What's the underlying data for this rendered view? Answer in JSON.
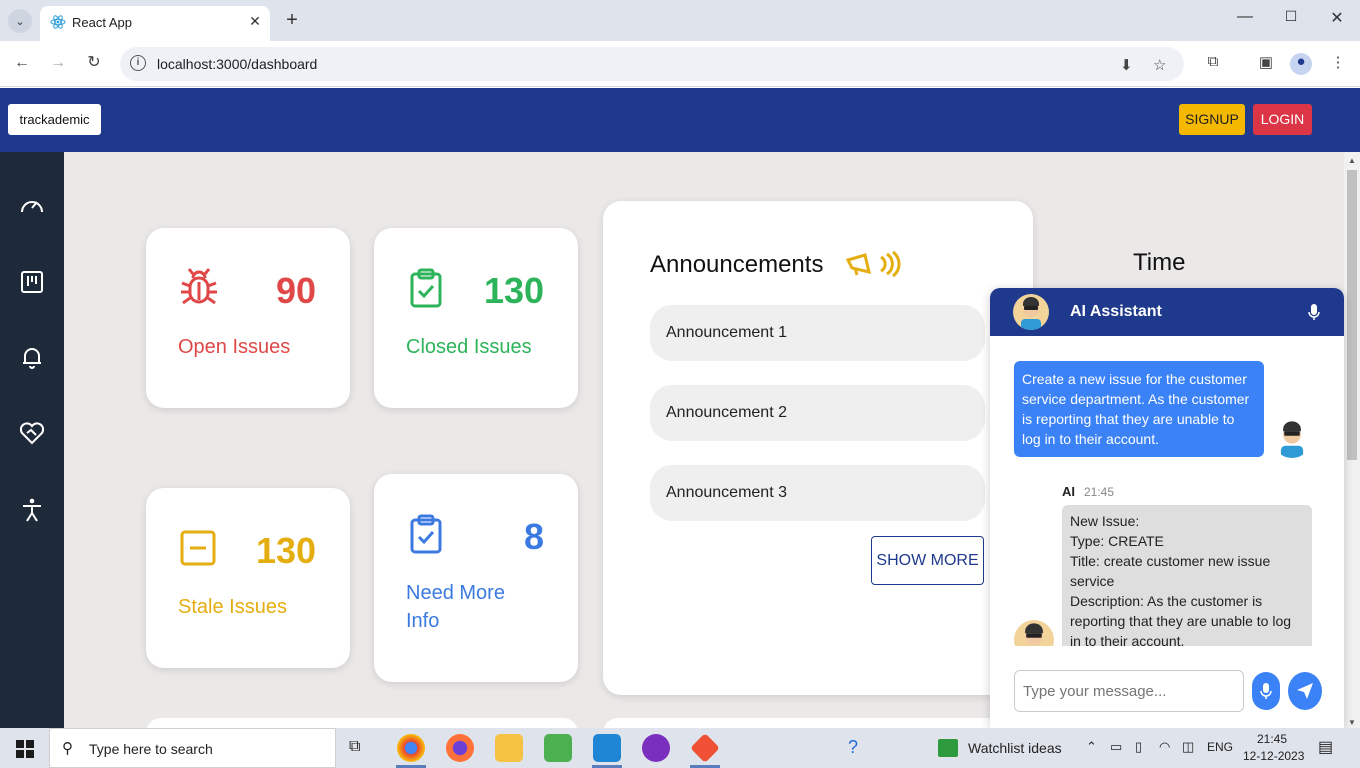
{
  "browser": {
    "tab_title": "React App",
    "url": "localhost:3000/dashboard"
  },
  "header": {
    "brand": "trackademic",
    "signup_label": "SIGNUP",
    "login_label": "LOGIN"
  },
  "sidebar": {
    "items": [
      "speedometer-icon",
      "kanban-icon",
      "bell-icon",
      "heart-handshake-icon",
      "accessibility-icon"
    ]
  },
  "cards": {
    "open": {
      "value": "90",
      "label": "Open Issues"
    },
    "closed": {
      "value": "130",
      "label": "Closed Issues"
    },
    "stale": {
      "value": "130",
      "label": "Stale Issues"
    },
    "info": {
      "value": "8",
      "label_line1": "Need More",
      "label_line2": "Info"
    }
  },
  "announcements": {
    "title": "Announcements",
    "items": [
      "Announcement 1",
      "Announcement 2",
      "Announcement 3"
    ],
    "show_more_label": "SHOW MORE"
  },
  "time": {
    "label": "Time"
  },
  "chat": {
    "title": "AI Assistant",
    "user_message": "Create a new issue for the customer service department. As the customer is reporting that they are unable to log in to their account.",
    "ai_name": "AI",
    "ai_time": "21:45",
    "ai_lines": [
      "New Issue:",
      "Type: CREATE",
      "Title: create customer new issue service",
      "Description: As the customer is reporting that they are unable to log in to their account."
    ],
    "input_placeholder": "Type your message..."
  },
  "taskbar": {
    "search_placeholder": "Type here to search",
    "weather_label": "Watchlist ideas",
    "lang": "ENG",
    "time": "21:45",
    "date": "12-12-2023"
  },
  "colors": {
    "header": "#1f3a8c",
    "open": "#e04848",
    "closed": "#2db35a",
    "stale": "#e5ae10",
    "info": "#3b7ae0"
  }
}
